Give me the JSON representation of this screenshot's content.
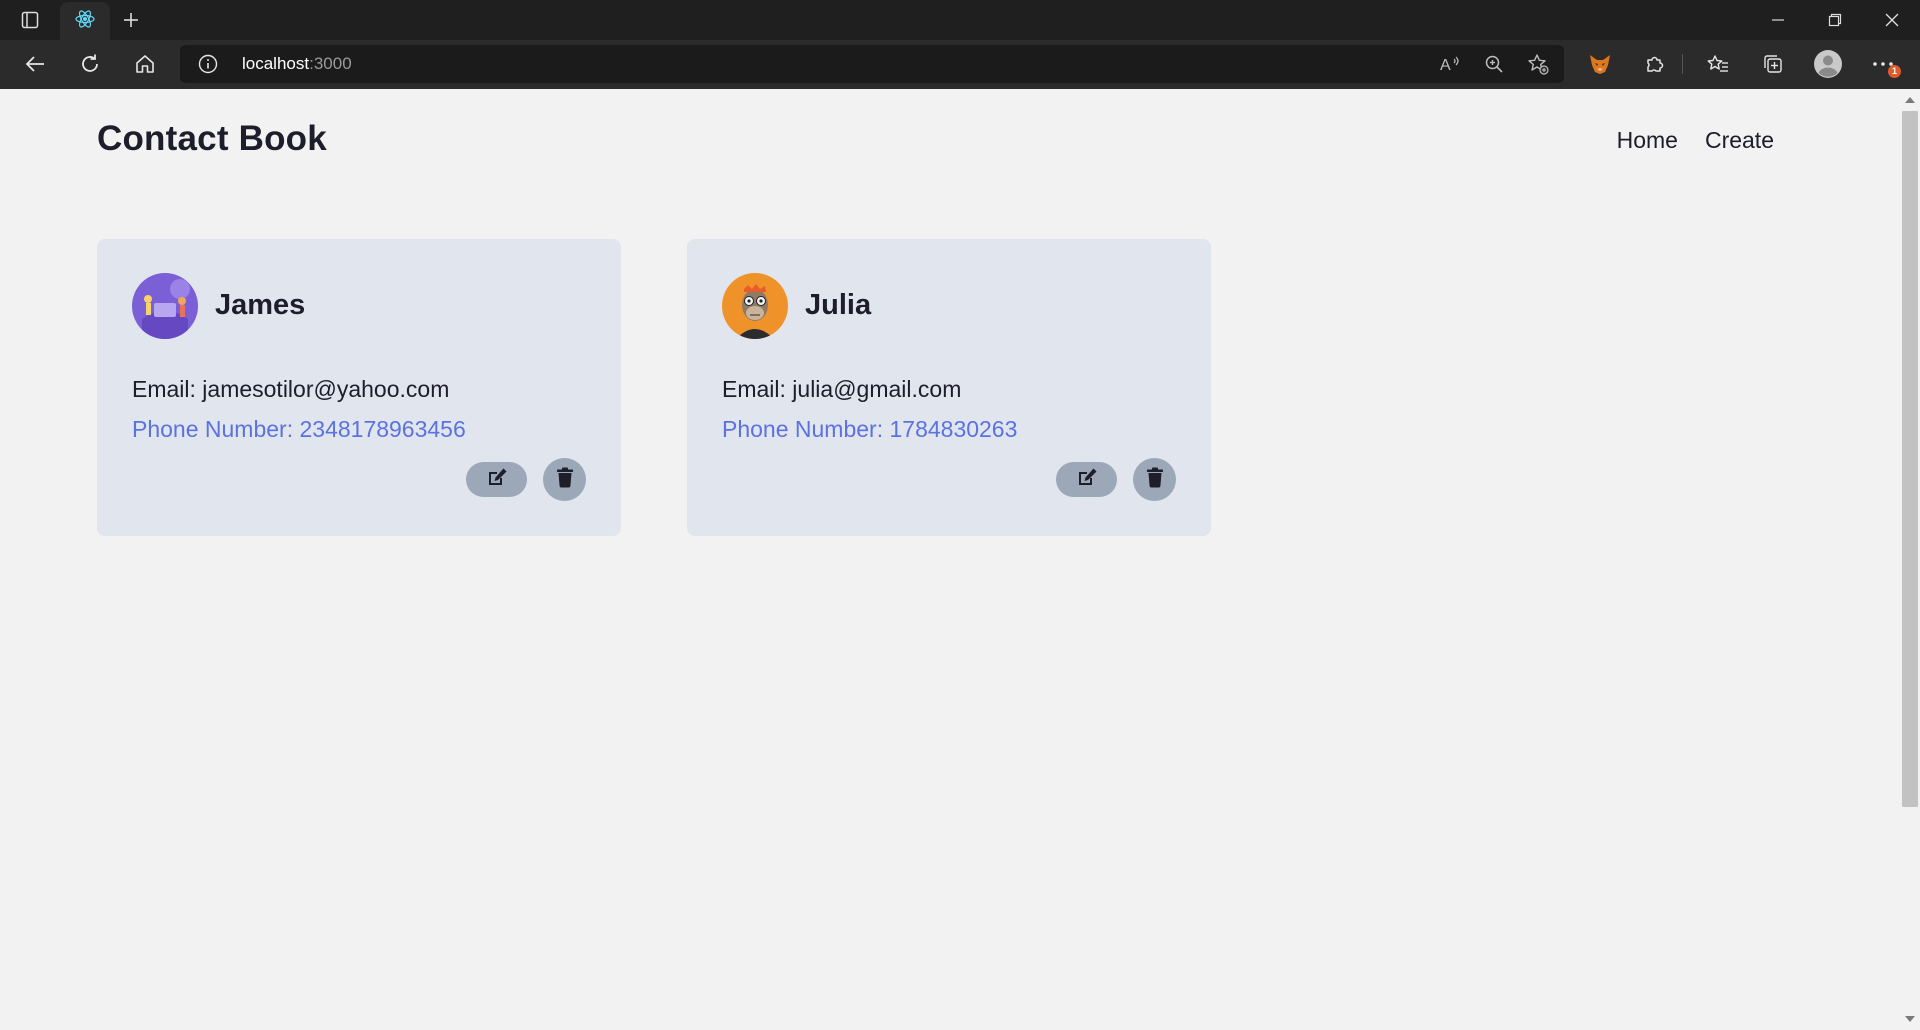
{
  "browser": {
    "address": {
      "host": "localhost",
      "port": ":3000"
    },
    "notification_count": "1",
    "icons": {
      "tab_actions": "tab-actions-icon",
      "tab_favicon": "react-icon",
      "new_tab": "plus-icon",
      "back": "back-arrow-icon",
      "refresh": "refresh-icon",
      "home": "home-icon",
      "site_info": "info-icon",
      "read_aloud": "read-aloud-icon",
      "zoom": "zoom-icon",
      "add_favorite": "star-add-icon",
      "extension_metamask": "fox-icon",
      "extensions": "puzzle-icon",
      "favorites": "favorites-icon",
      "collections": "collections-icon",
      "profile": "profile-icon",
      "menu": "more-icon"
    }
  },
  "app": {
    "brand": "Contact Book",
    "nav": [
      {
        "label": "Home"
      },
      {
        "label": "Create"
      }
    ]
  },
  "contacts": [
    {
      "name": "James",
      "email": "Email: jamesotilor@yahoo.com",
      "phone": "Phone Number: 2348178963456",
      "avatar_color": "#7b5fd6"
    },
    {
      "name": "Julia",
      "email": "Email: julia@gmail.com",
      "phone": "Phone Number: 1784830263",
      "avatar_color": "#f0922a"
    }
  ],
  "colors": {
    "page_bg": "#f2f2f2",
    "card_bg": "#e0e5ee",
    "phone_text": "#5b72e0",
    "action_button": "#9ca7b8"
  }
}
